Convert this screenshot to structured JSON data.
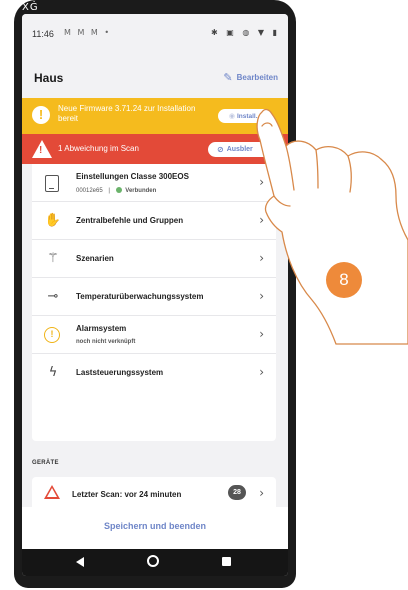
{
  "corner_icon": "XĠ",
  "status_bar": {
    "time": "11:46",
    "left_icons": "M M M •",
    "right_icons": "✱ ▣ ◍ ▼ ▮"
  },
  "header": {
    "title": "Haus",
    "edit_label": "Bearbeiten"
  },
  "firmware_banner": {
    "text": "Neue Firmware 3.71.24 zur Installation bereit",
    "button_label": "Install..."
  },
  "deviation_banner": {
    "text": "1 Abweichung im Scan",
    "button_label": "Ausbler"
  },
  "menu": {
    "items": [
      {
        "label": "Einstellungen Classe 300EOS",
        "sub_id": "00012e65",
        "sub_separator": "|",
        "sub_status": "Verbunden",
        "icon": "tablet-icon"
      },
      {
        "label": "Zentralbefehle und Gruppen",
        "icon": "hand-icon"
      },
      {
        "label": "Szenarien",
        "icon": "magic-wand-icon"
      },
      {
        "label": "Temperaturüberwachungssystem",
        "icon": "thermometer-icon"
      },
      {
        "label": "Alarmsystem",
        "sub": "noch nicht verknüpft",
        "icon": "alarm-icon"
      },
      {
        "label": "Laststeuerungssystem",
        "icon": "lightning-icon"
      }
    ]
  },
  "devices": {
    "section_label": "GERÄTE",
    "scan_label": "Letzter Scan: vor 24 minuten",
    "scan_count": "28"
  },
  "footer": {
    "save_label": "Speichern und beenden"
  },
  "step_marker": "8",
  "colors": {
    "firmware_banner": "#f5bb1e",
    "deviation_banner": "#e34a38",
    "accent": "#6f86c8",
    "step_marker": "#ee8a3a",
    "status_connected": "#6bb36b"
  }
}
